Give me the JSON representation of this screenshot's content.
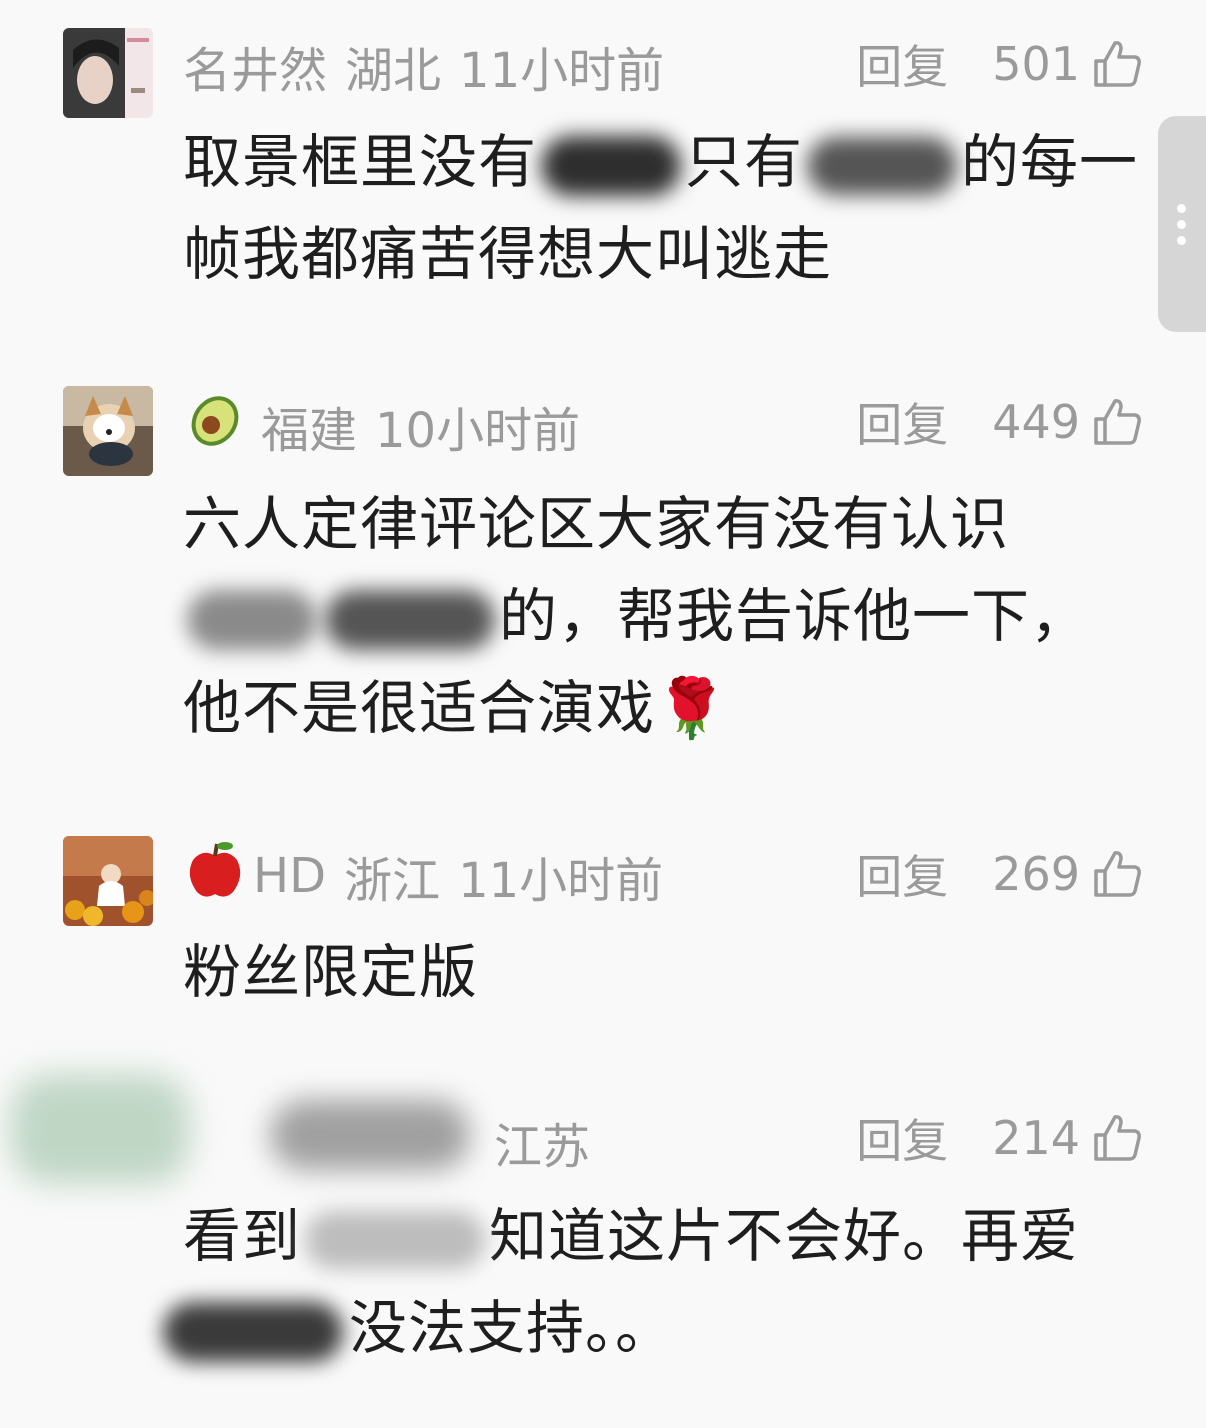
{
  "comments": [
    {
      "username": "名井然",
      "location": "湖北",
      "time": "11小时前",
      "reply_label": "回复",
      "likes": "501",
      "text_before": "取景框里没有",
      "text_middle": "只有",
      "text_after": "的每一帧我都痛苦得想大叫逃走"
    },
    {
      "username_emoji": "🥑",
      "location": "福建",
      "time": "10小时前",
      "reply_label": "回复",
      "likes": "449",
      "text_before": "六人定律评论区大家有没有认识",
      "text_after": "的，帮我告诉他一下，他不是很适合演戏",
      "text_emoji": "🌹"
    },
    {
      "username_emoji": "🍎",
      "username": "HD",
      "location": "浙江",
      "time": "11小时前",
      "reply_label": "回复",
      "likes": "269",
      "text": "粉丝限定版"
    },
    {
      "location": "江苏",
      "reply_label": "回复",
      "likes": "214",
      "text_before": "看到",
      "text_middle": "知道这片不会好。再爱",
      "text_after": "没法支持。。"
    }
  ]
}
